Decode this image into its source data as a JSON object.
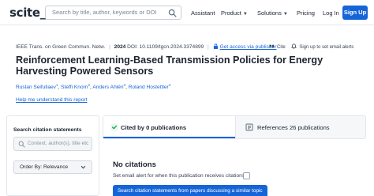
{
  "nav": {
    "logo": "scite_",
    "search_placeholder": "Search by title, author, keywords or DOI",
    "links": {
      "assistant": "Assistant",
      "product": "Product",
      "solutions": "Solutions",
      "pricing": "Pricing",
      "login": "Log In"
    },
    "signup": "Sign Up"
  },
  "paper": {
    "journal": "IEEE Trans. on Green Commun. Netw.",
    "year": "2024",
    "doi": "DOI: 10.1109/tgcn.2024.3374899",
    "access_link": "Get access via publisher",
    "cite_label": "Cite",
    "alert_label": "Sign up to set email alerts",
    "title": "Reinforcement Learning-Based Transmission Policies for Energy Harvesting Powered Sensors",
    "authors": [
      {
        "name": "Ruslan Seifullaev",
        "sup": "1"
      },
      {
        "name": "Steffi Knorn",
        "sup": "2"
      },
      {
        "name": "Anders Ahlén",
        "sup": "3"
      },
      {
        "name": "Roland Hostettler",
        "sup": "4"
      }
    ],
    "help_link": "Help me understand this report"
  },
  "sidebar": {
    "heading": "Search citation statements",
    "context_placeholder": "Context, author(s), title etc",
    "order_label": "Order By: Relevance"
  },
  "tabs": {
    "cited_by": "Cited by 0 publications",
    "references": "References 26 publications"
  },
  "main": {
    "no_citations": "No citations",
    "alert_text": "Set email alert for when this publication receives citations?",
    "cta": "Search citation statements from papers discussing a similar topic"
  },
  "colors": {
    "accent": "#1565d8",
    "text": "#1c2430",
    "muted": "#3a4454"
  }
}
